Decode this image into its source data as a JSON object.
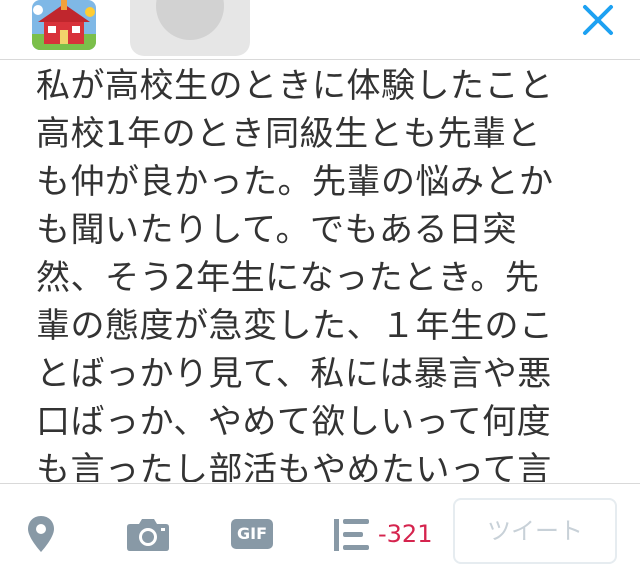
{
  "header": {
    "avatar_icon": "schoolhouse-avatar-icon",
    "close_icon": "close-icon",
    "accent_color": "#1da1f2"
  },
  "compose": {
    "text": "私が高校生のときに体験したこと\n高校1年のとき同級生とも先輩と\nも仲が良かった。先輩の悩みとか\nも聞いたりして。でもある日突\n然、そう2年生になったとき。先\n輩の態度が急変した、１年生のこ\nとばっかり見て、私には暴言や悪\n口ばっか、やめて欲しいって何度\nも言ったし部活もやめたいって言"
  },
  "toolbar": {
    "location_icon": "location-pin-icon",
    "camera_icon": "camera-icon",
    "gif_label": "GIF",
    "thread_icon": "add-thread-icon",
    "char_counter": "-321",
    "counter_color": "#d5244e",
    "tweet_label": "ツイート"
  }
}
